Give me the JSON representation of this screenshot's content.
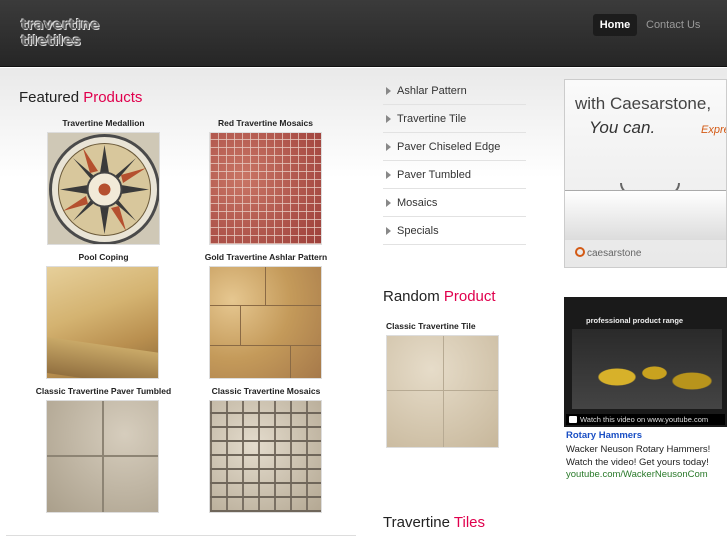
{
  "header": {
    "logo_line1": "travertine",
    "logo_line2": "tiletiles",
    "nav": [
      {
        "label": "Home"
      },
      {
        "label": "Contact Us"
      }
    ]
  },
  "featured": {
    "title_plain": "Featured",
    "title_accent": "Products",
    "products": [
      {
        "label": "Travertine Medallion"
      },
      {
        "label": "Red Travertine Mosaics"
      },
      {
        "label": "Pool Coping"
      },
      {
        "label": "Gold Travertine Ashlar Pattern"
      },
      {
        "label": "Classic Travertine Paver Tumbled"
      },
      {
        "label": "Classic Travertine Mosaics"
      }
    ]
  },
  "menu": {
    "items": [
      {
        "label": "Ashlar Pattern"
      },
      {
        "label": "Travertine Tile"
      },
      {
        "label": "Paver Chiseled Edge"
      },
      {
        "label": "Paver Tumbled"
      },
      {
        "label": "Mosaics"
      },
      {
        "label": "Specials"
      }
    ]
  },
  "random": {
    "title_plain": "Random",
    "title_accent": "Product",
    "product_label": "Classic Travertine Tile"
  },
  "tiles_section": {
    "title_plain": "Travertine",
    "title_accent": "Tiles"
  },
  "ad1": {
    "line1": "with Caesarstone,",
    "line2": "You can.",
    "fragment": "Expre",
    "brand": "caesarstone"
  },
  "ad2": {
    "banner": "professional product range",
    "watch_text": "Watch this video on www.youtube.com",
    "title": "Rotary Hammers",
    "text": "Wacker Neuson Rotary Hammers! Watch the video! Get yours today!",
    "url": "youtube.com/WackerNeusonCom"
  },
  "colors": {
    "accent": "#e0004d",
    "header_bg": "#2e2e2e"
  }
}
